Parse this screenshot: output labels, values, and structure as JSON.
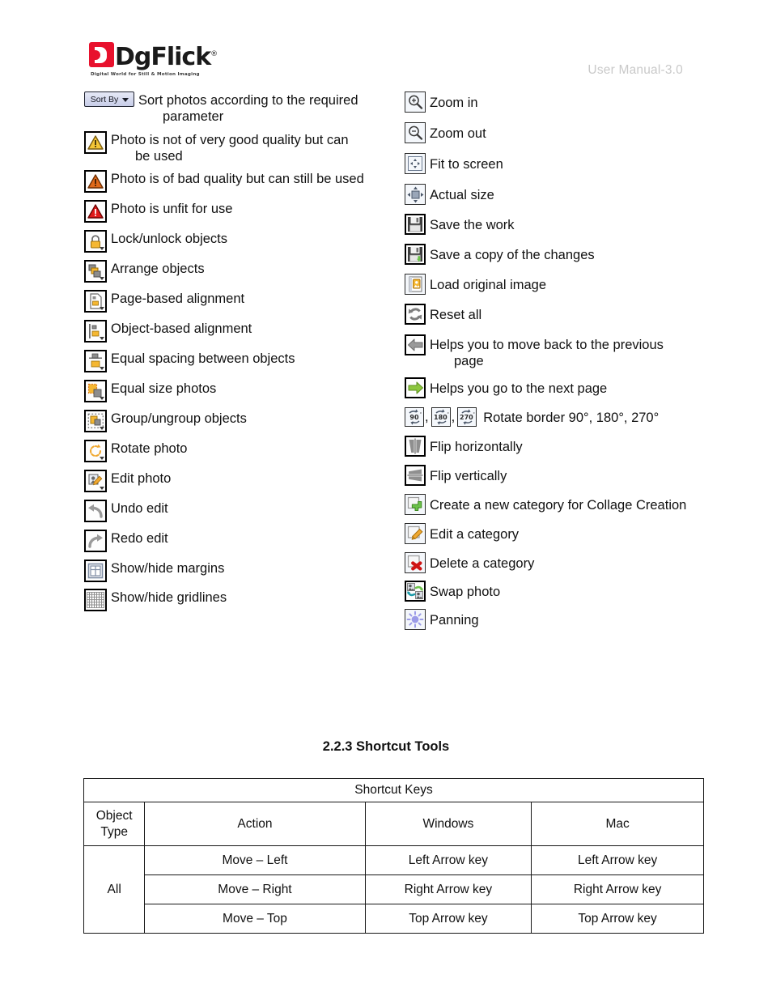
{
  "header": {
    "logo_text": "DgFlick",
    "logo_registered": "®",
    "logo_tagline": "Digital World for Still & Motion Imaging",
    "manual_label": "User Manual-3.0"
  },
  "legend": {
    "left_column": [
      {
        "icon": "sort-by-dropdown",
        "button_label": "Sort By",
        "caption_line1": "Sort photos according to the required",
        "caption_line2": "parameter"
      },
      {
        "icon": "warning-triangle-yellow-icon",
        "caption_line1": "Photo is not of very good quality but can",
        "caption_line2": "be used"
      },
      {
        "icon": "warning-triangle-orange-icon",
        "caption_line1": "Photo is of bad quality but can still be used"
      },
      {
        "icon": "warning-triangle-red-icon",
        "caption_line1": "Photo is unfit for use"
      },
      {
        "icon": "lock-icon",
        "caption_line1": "Lock/unlock objects"
      },
      {
        "icon": "arrange-objects-icon",
        "caption_line1": "Arrange objects"
      },
      {
        "icon": "page-based-alignment-icon",
        "caption_line1": "Page-based alignment"
      },
      {
        "icon": "object-based-alignment-icon",
        "caption_line1": "Object-based alignment"
      },
      {
        "icon": "equal-spacing-icon",
        "caption_line1": "Equal spacing between objects"
      },
      {
        "icon": "equal-size-photos-icon",
        "caption_line1": "Equal size photos"
      },
      {
        "icon": "group-ungroup-icon",
        "caption_line1": "Group/ungroup objects"
      },
      {
        "icon": "rotate-photo-icon",
        "caption_line1": "Rotate photo"
      },
      {
        "icon": "edit-photo-icon",
        "caption_line1": "Edit photo"
      },
      {
        "icon": "undo-icon",
        "caption_line1": "Undo edit"
      },
      {
        "icon": "redo-icon",
        "caption_line1": "Redo edit"
      },
      {
        "icon": "show-hide-margins-icon",
        "caption_line1": "Show/hide margins"
      },
      {
        "icon": "show-hide-gridlines-icon",
        "caption_line1": "Show/hide gridlines"
      }
    ],
    "right_column": [
      {
        "icon": "zoom-in-icon",
        "caption_line1": "Zoom in"
      },
      {
        "icon": "zoom-out-icon",
        "caption_line1": "Zoom out"
      },
      {
        "icon": "fit-to-screen-icon",
        "caption_line1": "Fit to screen"
      },
      {
        "icon": "actual-size-icon",
        "caption_line1": "Actual size"
      },
      {
        "icon": "save-icon",
        "caption_line1": "Save the work"
      },
      {
        "icon": "save-copy-icon",
        "caption_line1": "Save a copy of the changes"
      },
      {
        "icon": "load-original-image-icon",
        "caption_line1": "Load original image"
      },
      {
        "icon": "reset-all-icon",
        "caption_line1": "Reset all"
      },
      {
        "icon": "previous-page-arrow-icon",
        "caption_line1": "Helps you to move back to the previous",
        "caption_line2": "page"
      },
      {
        "icon": "next-page-arrow-icon",
        "caption_line1": "Helps you go to the next page"
      },
      {
        "icon": "rotate-border-group-icon",
        "rotate_labels": [
          "90",
          "180",
          "270"
        ],
        "separator": ",",
        "caption_line1": "Rotate border 90°, 180°, 270°"
      },
      {
        "icon": "flip-horizontally-icon",
        "caption_line1": "Flip horizontally"
      },
      {
        "icon": "flip-vertically-icon",
        "caption_line1": "Flip vertically"
      },
      {
        "icon": "create-category-icon",
        "caption_line1": "Create a new category for Collage Creation"
      },
      {
        "icon": "edit-category-icon",
        "caption_line1": "Edit a category"
      },
      {
        "icon": "delete-category-icon",
        "caption_line1": "Delete a category"
      },
      {
        "icon": "swap-photo-icon",
        "caption_line1": "Swap photo"
      },
      {
        "icon": "panning-icon",
        "caption_line1": "Panning"
      }
    ]
  },
  "section": {
    "heading": "2.2.3 Shortcut Tools"
  },
  "table": {
    "title": "Shortcut Keys",
    "headers": [
      "Object Type",
      "Action",
      "Windows",
      "Mac"
    ],
    "header_obj_line1": "Object",
    "header_obj_line2": "Type",
    "header_action": "Action",
    "header_windows": "Windows",
    "header_mac": "Mac",
    "object_type_value": "All",
    "rows": [
      {
        "action": "Move – Left",
        "windows": "Left Arrow key",
        "mac": "Left Arrow key"
      },
      {
        "action": "Move – Right",
        "windows": "Right Arrow key",
        "mac": "Right Arrow key"
      },
      {
        "action": "Move – Top",
        "windows": "Top Arrow key",
        "mac": "Top Arrow key"
      }
    ]
  },
  "colors": {
    "brand_red": "#e8112d",
    "manual_gray": "#c9c9c9",
    "warn_yellow": "#f5c636",
    "warn_orange": "#e06a1b",
    "warn_red": "#e01b1b",
    "accent_orange": "#f0a830",
    "accent_green": "#6cc24a",
    "accent_purple": "#9b9be8"
  }
}
